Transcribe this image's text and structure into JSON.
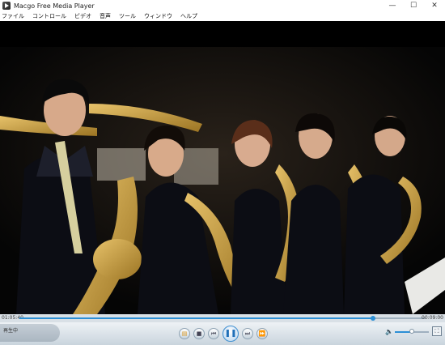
{
  "window": {
    "title": "Macgo Free Media Player",
    "minimize": "—",
    "maximize": "☐",
    "close": "✕",
    "app_icon": "play-app-icon"
  },
  "menu": [
    "ファイル",
    "コントロール",
    "ビデオ",
    "音声",
    "ツール",
    "ウィンドウ",
    "ヘルプ"
  ],
  "video": {
    "description_icon": "concert-video-frame",
    "colors": {
      "bg": "#000000"
    }
  },
  "timeline": {
    "current": "01:05:40",
    "total": "00:09:00",
    "progress": 0.87
  },
  "controls": {
    "status": "再生中",
    "open_icon": "open-folder-icon",
    "stop_icon": "stop-icon",
    "prev_icon": "previous-icon",
    "play_pause_icon": "pause-icon",
    "next_icon": "next-icon",
    "fast_icon": "fast-forward-icon",
    "volume_level": 0.5,
    "volume_icon": "speaker-icon",
    "fullscreen_icon": "fullscreen-icon"
  },
  "colors": {
    "accent": "#2c8fd6"
  }
}
